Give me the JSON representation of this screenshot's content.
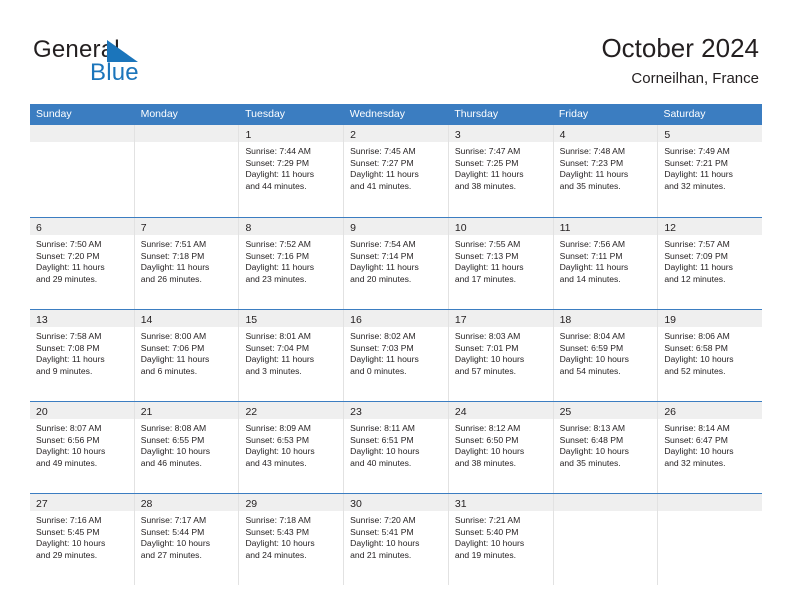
{
  "brand": {
    "name_top": "General",
    "name_bottom": "Blue",
    "flag_icon": "blue-triangle-flag-icon",
    "color_top": "#231f20",
    "color_bottom": "#1b75bb"
  },
  "header": {
    "title": "October 2024",
    "subtitle": "Corneilhan, France"
  },
  "theme": {
    "header_blue": "#3b7dc1",
    "day_band_gray": "#efefef",
    "grid_line": "#e2e2e2",
    "text": "#231f20"
  },
  "weekdays": [
    "Sunday",
    "Monday",
    "Tuesday",
    "Wednesday",
    "Thursday",
    "Friday",
    "Saturday"
  ],
  "weeks": [
    [
      {
        "day": "",
        "empty": true
      },
      {
        "day": "",
        "empty": true
      },
      {
        "day": "1",
        "sunrise": "Sunrise: 7:44 AM",
        "sunset": "Sunset: 7:29 PM",
        "daylight1": "Daylight: 11 hours",
        "daylight2": "and 44 minutes."
      },
      {
        "day": "2",
        "sunrise": "Sunrise: 7:45 AM",
        "sunset": "Sunset: 7:27 PM",
        "daylight1": "Daylight: 11 hours",
        "daylight2": "and 41 minutes."
      },
      {
        "day": "3",
        "sunrise": "Sunrise: 7:47 AM",
        "sunset": "Sunset: 7:25 PM",
        "daylight1": "Daylight: 11 hours",
        "daylight2": "and 38 minutes."
      },
      {
        "day": "4",
        "sunrise": "Sunrise: 7:48 AM",
        "sunset": "Sunset: 7:23 PM",
        "daylight1": "Daylight: 11 hours",
        "daylight2": "and 35 minutes."
      },
      {
        "day": "5",
        "sunrise": "Sunrise: 7:49 AM",
        "sunset": "Sunset: 7:21 PM",
        "daylight1": "Daylight: 11 hours",
        "daylight2": "and 32 minutes."
      }
    ],
    [
      {
        "day": "6",
        "sunrise": "Sunrise: 7:50 AM",
        "sunset": "Sunset: 7:20 PM",
        "daylight1": "Daylight: 11 hours",
        "daylight2": "and 29 minutes."
      },
      {
        "day": "7",
        "sunrise": "Sunrise: 7:51 AM",
        "sunset": "Sunset: 7:18 PM",
        "daylight1": "Daylight: 11 hours",
        "daylight2": "and 26 minutes."
      },
      {
        "day": "8",
        "sunrise": "Sunrise: 7:52 AM",
        "sunset": "Sunset: 7:16 PM",
        "daylight1": "Daylight: 11 hours",
        "daylight2": "and 23 minutes."
      },
      {
        "day": "9",
        "sunrise": "Sunrise: 7:54 AM",
        "sunset": "Sunset: 7:14 PM",
        "daylight1": "Daylight: 11 hours",
        "daylight2": "and 20 minutes."
      },
      {
        "day": "10",
        "sunrise": "Sunrise: 7:55 AM",
        "sunset": "Sunset: 7:13 PM",
        "daylight1": "Daylight: 11 hours",
        "daylight2": "and 17 minutes."
      },
      {
        "day": "11",
        "sunrise": "Sunrise: 7:56 AM",
        "sunset": "Sunset: 7:11 PM",
        "daylight1": "Daylight: 11 hours",
        "daylight2": "and 14 minutes."
      },
      {
        "day": "12",
        "sunrise": "Sunrise: 7:57 AM",
        "sunset": "Sunset: 7:09 PM",
        "daylight1": "Daylight: 11 hours",
        "daylight2": "and 12 minutes."
      }
    ],
    [
      {
        "day": "13",
        "sunrise": "Sunrise: 7:58 AM",
        "sunset": "Sunset: 7:08 PM",
        "daylight1": "Daylight: 11 hours",
        "daylight2": "and 9 minutes."
      },
      {
        "day": "14",
        "sunrise": "Sunrise: 8:00 AM",
        "sunset": "Sunset: 7:06 PM",
        "daylight1": "Daylight: 11 hours",
        "daylight2": "and 6 minutes."
      },
      {
        "day": "15",
        "sunrise": "Sunrise: 8:01 AM",
        "sunset": "Sunset: 7:04 PM",
        "daylight1": "Daylight: 11 hours",
        "daylight2": "and 3 minutes."
      },
      {
        "day": "16",
        "sunrise": "Sunrise: 8:02 AM",
        "sunset": "Sunset: 7:03 PM",
        "daylight1": "Daylight: 11 hours",
        "daylight2": "and 0 minutes."
      },
      {
        "day": "17",
        "sunrise": "Sunrise: 8:03 AM",
        "sunset": "Sunset: 7:01 PM",
        "daylight1": "Daylight: 10 hours",
        "daylight2": "and 57 minutes."
      },
      {
        "day": "18",
        "sunrise": "Sunrise: 8:04 AM",
        "sunset": "Sunset: 6:59 PM",
        "daylight1": "Daylight: 10 hours",
        "daylight2": "and 54 minutes."
      },
      {
        "day": "19",
        "sunrise": "Sunrise: 8:06 AM",
        "sunset": "Sunset: 6:58 PM",
        "daylight1": "Daylight: 10 hours",
        "daylight2": "and 52 minutes."
      }
    ],
    [
      {
        "day": "20",
        "sunrise": "Sunrise: 8:07 AM",
        "sunset": "Sunset: 6:56 PM",
        "daylight1": "Daylight: 10 hours",
        "daylight2": "and 49 minutes."
      },
      {
        "day": "21",
        "sunrise": "Sunrise: 8:08 AM",
        "sunset": "Sunset: 6:55 PM",
        "daylight1": "Daylight: 10 hours",
        "daylight2": "and 46 minutes."
      },
      {
        "day": "22",
        "sunrise": "Sunrise: 8:09 AM",
        "sunset": "Sunset: 6:53 PM",
        "daylight1": "Daylight: 10 hours",
        "daylight2": "and 43 minutes."
      },
      {
        "day": "23",
        "sunrise": "Sunrise: 8:11 AM",
        "sunset": "Sunset: 6:51 PM",
        "daylight1": "Daylight: 10 hours",
        "daylight2": "and 40 minutes."
      },
      {
        "day": "24",
        "sunrise": "Sunrise: 8:12 AM",
        "sunset": "Sunset: 6:50 PM",
        "daylight1": "Daylight: 10 hours",
        "daylight2": "and 38 minutes."
      },
      {
        "day": "25",
        "sunrise": "Sunrise: 8:13 AM",
        "sunset": "Sunset: 6:48 PM",
        "daylight1": "Daylight: 10 hours",
        "daylight2": "and 35 minutes."
      },
      {
        "day": "26",
        "sunrise": "Sunrise: 8:14 AM",
        "sunset": "Sunset: 6:47 PM",
        "daylight1": "Daylight: 10 hours",
        "daylight2": "and 32 minutes."
      }
    ],
    [
      {
        "day": "27",
        "sunrise": "Sunrise: 7:16 AM",
        "sunset": "Sunset: 5:45 PM",
        "daylight1": "Daylight: 10 hours",
        "daylight2": "and 29 minutes."
      },
      {
        "day": "28",
        "sunrise": "Sunrise: 7:17 AM",
        "sunset": "Sunset: 5:44 PM",
        "daylight1": "Daylight: 10 hours",
        "daylight2": "and 27 minutes."
      },
      {
        "day": "29",
        "sunrise": "Sunrise: 7:18 AM",
        "sunset": "Sunset: 5:43 PM",
        "daylight1": "Daylight: 10 hours",
        "daylight2": "and 24 minutes."
      },
      {
        "day": "30",
        "sunrise": "Sunrise: 7:20 AM",
        "sunset": "Sunset: 5:41 PM",
        "daylight1": "Daylight: 10 hours",
        "daylight2": "and 21 minutes."
      },
      {
        "day": "31",
        "sunrise": "Sunrise: 7:21 AM",
        "sunset": "Sunset: 5:40 PM",
        "daylight1": "Daylight: 10 hours",
        "daylight2": "and 19 minutes."
      },
      {
        "day": "",
        "empty": true
      },
      {
        "day": "",
        "empty": true
      }
    ]
  ]
}
